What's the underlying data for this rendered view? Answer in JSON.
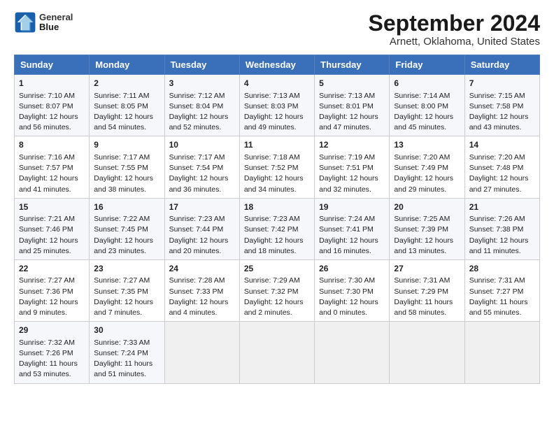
{
  "logo": {
    "line1": "General",
    "line2": "Blue"
  },
  "title": "September 2024",
  "subtitle": "Arnett, Oklahoma, United States",
  "days_header": [
    "Sunday",
    "Monday",
    "Tuesday",
    "Wednesday",
    "Thursday",
    "Friday",
    "Saturday"
  ],
  "weeks": [
    [
      {
        "num": "1",
        "lines": [
          "Sunrise: 7:10 AM",
          "Sunset: 8:07 PM",
          "Daylight: 12 hours",
          "and 56 minutes."
        ]
      },
      {
        "num": "2",
        "lines": [
          "Sunrise: 7:11 AM",
          "Sunset: 8:05 PM",
          "Daylight: 12 hours",
          "and 54 minutes."
        ]
      },
      {
        "num": "3",
        "lines": [
          "Sunrise: 7:12 AM",
          "Sunset: 8:04 PM",
          "Daylight: 12 hours",
          "and 52 minutes."
        ]
      },
      {
        "num": "4",
        "lines": [
          "Sunrise: 7:13 AM",
          "Sunset: 8:03 PM",
          "Daylight: 12 hours",
          "and 49 minutes."
        ]
      },
      {
        "num": "5",
        "lines": [
          "Sunrise: 7:13 AM",
          "Sunset: 8:01 PM",
          "Daylight: 12 hours",
          "and 47 minutes."
        ]
      },
      {
        "num": "6",
        "lines": [
          "Sunrise: 7:14 AM",
          "Sunset: 8:00 PM",
          "Daylight: 12 hours",
          "and 45 minutes."
        ]
      },
      {
        "num": "7",
        "lines": [
          "Sunrise: 7:15 AM",
          "Sunset: 7:58 PM",
          "Daylight: 12 hours",
          "and 43 minutes."
        ]
      }
    ],
    [
      {
        "num": "8",
        "lines": [
          "Sunrise: 7:16 AM",
          "Sunset: 7:57 PM",
          "Daylight: 12 hours",
          "and 41 minutes."
        ]
      },
      {
        "num": "9",
        "lines": [
          "Sunrise: 7:17 AM",
          "Sunset: 7:55 PM",
          "Daylight: 12 hours",
          "and 38 minutes."
        ]
      },
      {
        "num": "10",
        "lines": [
          "Sunrise: 7:17 AM",
          "Sunset: 7:54 PM",
          "Daylight: 12 hours",
          "and 36 minutes."
        ]
      },
      {
        "num": "11",
        "lines": [
          "Sunrise: 7:18 AM",
          "Sunset: 7:52 PM",
          "Daylight: 12 hours",
          "and 34 minutes."
        ]
      },
      {
        "num": "12",
        "lines": [
          "Sunrise: 7:19 AM",
          "Sunset: 7:51 PM",
          "Daylight: 12 hours",
          "and 32 minutes."
        ]
      },
      {
        "num": "13",
        "lines": [
          "Sunrise: 7:20 AM",
          "Sunset: 7:49 PM",
          "Daylight: 12 hours",
          "and 29 minutes."
        ]
      },
      {
        "num": "14",
        "lines": [
          "Sunrise: 7:20 AM",
          "Sunset: 7:48 PM",
          "Daylight: 12 hours",
          "and 27 minutes."
        ]
      }
    ],
    [
      {
        "num": "15",
        "lines": [
          "Sunrise: 7:21 AM",
          "Sunset: 7:46 PM",
          "Daylight: 12 hours",
          "and 25 minutes."
        ]
      },
      {
        "num": "16",
        "lines": [
          "Sunrise: 7:22 AM",
          "Sunset: 7:45 PM",
          "Daylight: 12 hours",
          "and 23 minutes."
        ]
      },
      {
        "num": "17",
        "lines": [
          "Sunrise: 7:23 AM",
          "Sunset: 7:44 PM",
          "Daylight: 12 hours",
          "and 20 minutes."
        ]
      },
      {
        "num": "18",
        "lines": [
          "Sunrise: 7:23 AM",
          "Sunset: 7:42 PM",
          "Daylight: 12 hours",
          "and 18 minutes."
        ]
      },
      {
        "num": "19",
        "lines": [
          "Sunrise: 7:24 AM",
          "Sunset: 7:41 PM",
          "Daylight: 12 hours",
          "and 16 minutes."
        ]
      },
      {
        "num": "20",
        "lines": [
          "Sunrise: 7:25 AM",
          "Sunset: 7:39 PM",
          "Daylight: 12 hours",
          "and 13 minutes."
        ]
      },
      {
        "num": "21",
        "lines": [
          "Sunrise: 7:26 AM",
          "Sunset: 7:38 PM",
          "Daylight: 12 hours",
          "and 11 minutes."
        ]
      }
    ],
    [
      {
        "num": "22",
        "lines": [
          "Sunrise: 7:27 AM",
          "Sunset: 7:36 PM",
          "Daylight: 12 hours",
          "and 9 minutes."
        ]
      },
      {
        "num": "23",
        "lines": [
          "Sunrise: 7:27 AM",
          "Sunset: 7:35 PM",
          "Daylight: 12 hours",
          "and 7 minutes."
        ]
      },
      {
        "num": "24",
        "lines": [
          "Sunrise: 7:28 AM",
          "Sunset: 7:33 PM",
          "Daylight: 12 hours",
          "and 4 minutes."
        ]
      },
      {
        "num": "25",
        "lines": [
          "Sunrise: 7:29 AM",
          "Sunset: 7:32 PM",
          "Daylight: 12 hours",
          "and 2 minutes."
        ]
      },
      {
        "num": "26",
        "lines": [
          "Sunrise: 7:30 AM",
          "Sunset: 7:30 PM",
          "Daylight: 12 hours",
          "and 0 minutes."
        ]
      },
      {
        "num": "27",
        "lines": [
          "Sunrise: 7:31 AM",
          "Sunset: 7:29 PM",
          "Daylight: 11 hours",
          "and 58 minutes."
        ]
      },
      {
        "num": "28",
        "lines": [
          "Sunrise: 7:31 AM",
          "Sunset: 7:27 PM",
          "Daylight: 11 hours",
          "and 55 minutes."
        ]
      }
    ],
    [
      {
        "num": "29",
        "lines": [
          "Sunrise: 7:32 AM",
          "Sunset: 7:26 PM",
          "Daylight: 11 hours",
          "and 53 minutes."
        ]
      },
      {
        "num": "30",
        "lines": [
          "Sunrise: 7:33 AM",
          "Sunset: 7:24 PM",
          "Daylight: 11 hours",
          "and 51 minutes."
        ]
      },
      {
        "num": "",
        "lines": [],
        "empty": true
      },
      {
        "num": "",
        "lines": [],
        "empty": true
      },
      {
        "num": "",
        "lines": [],
        "empty": true
      },
      {
        "num": "",
        "lines": [],
        "empty": true
      },
      {
        "num": "",
        "lines": [],
        "empty": true
      }
    ]
  ]
}
